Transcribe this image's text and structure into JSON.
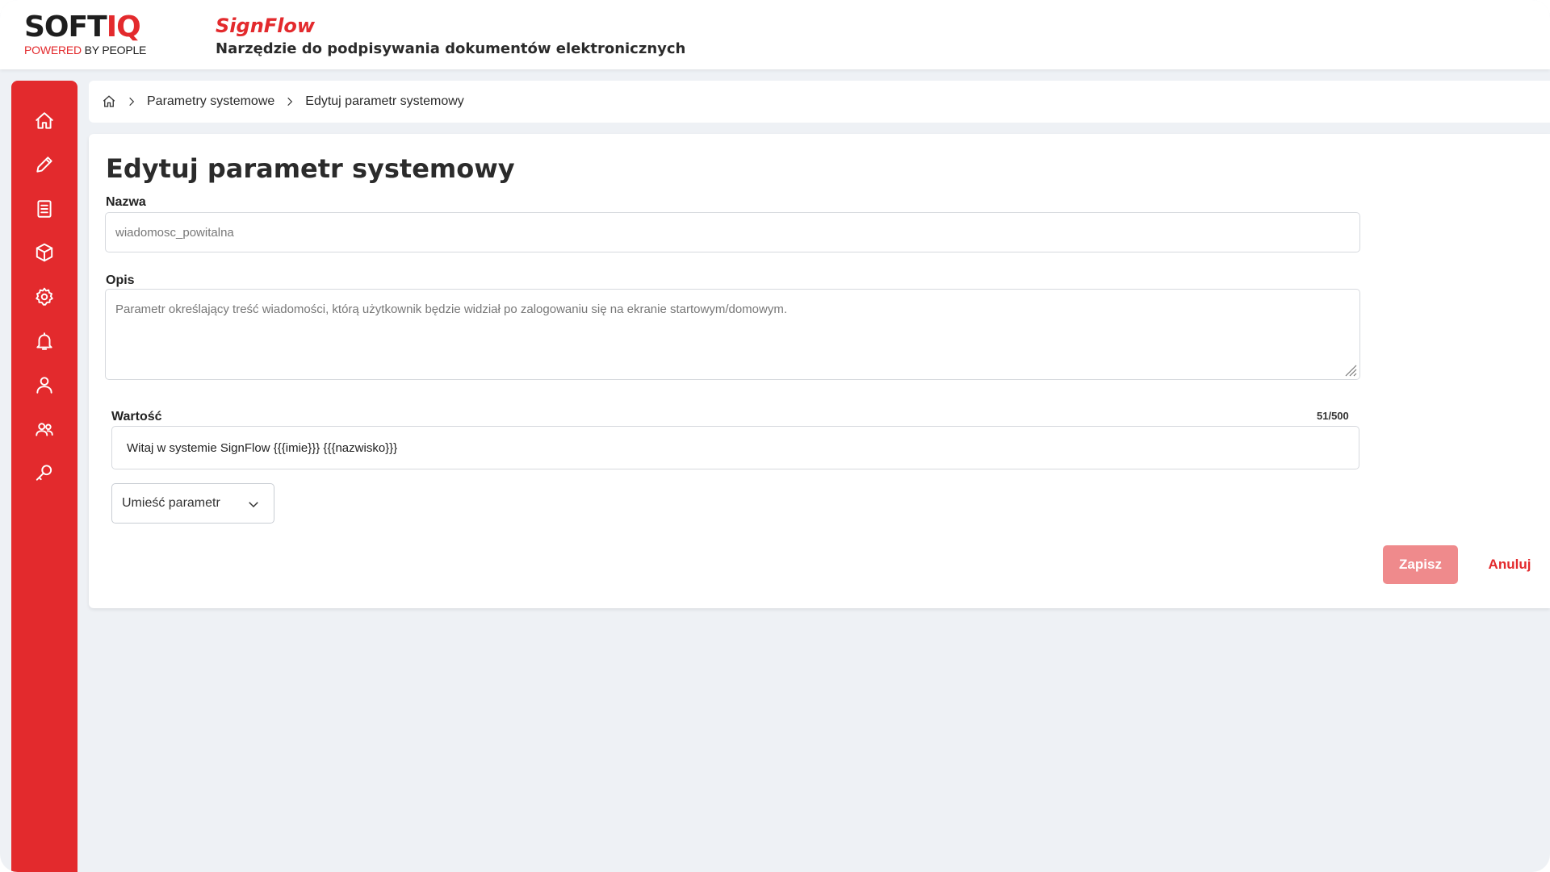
{
  "header": {
    "logo_main": "SOFT",
    "logo_accent": "IQ",
    "logo_tagline_1": "POWERED",
    "logo_tagline_2": " BY PEOPLE",
    "app_name": "SignFlow",
    "app_description": "Narzędzie do podpisywania dokumentów elektronicznych"
  },
  "sidebar": {
    "items": [
      {
        "icon": "home-icon"
      },
      {
        "icon": "pencil-icon"
      },
      {
        "icon": "document-list-icon"
      },
      {
        "icon": "box-icon"
      },
      {
        "icon": "gear-icon"
      },
      {
        "icon": "bell-icon"
      },
      {
        "icon": "user-icon"
      },
      {
        "icon": "users-icon"
      },
      {
        "icon": "key-icon"
      }
    ]
  },
  "breadcrumb": {
    "items": [
      "Parametry systemowe",
      "Edytuj parametr systemowy"
    ]
  },
  "form": {
    "title": "Edytuj parametr systemowy",
    "name_label": "Nazwa",
    "name_value": "wiadomosc_powitalna",
    "description_label": "Opis",
    "description_value": "Parametr określający treść wiadomości, którą użytkownik będzie widział po zalogowaniu się na ekranie startowym/domowym.",
    "value_label": "Wartość",
    "value_counter": "51/500",
    "value_text": "Witaj w systemie SignFlow {{{imie}}} {{{nazwisko}}}",
    "insert_param_label": "Umieść parametr",
    "save_label": "Zapisz",
    "cancel_label": "Anuluj"
  },
  "colors": {
    "brand_red": "#e32a2d",
    "save_button": "#ef8a8c",
    "background": "#eef1f5"
  }
}
